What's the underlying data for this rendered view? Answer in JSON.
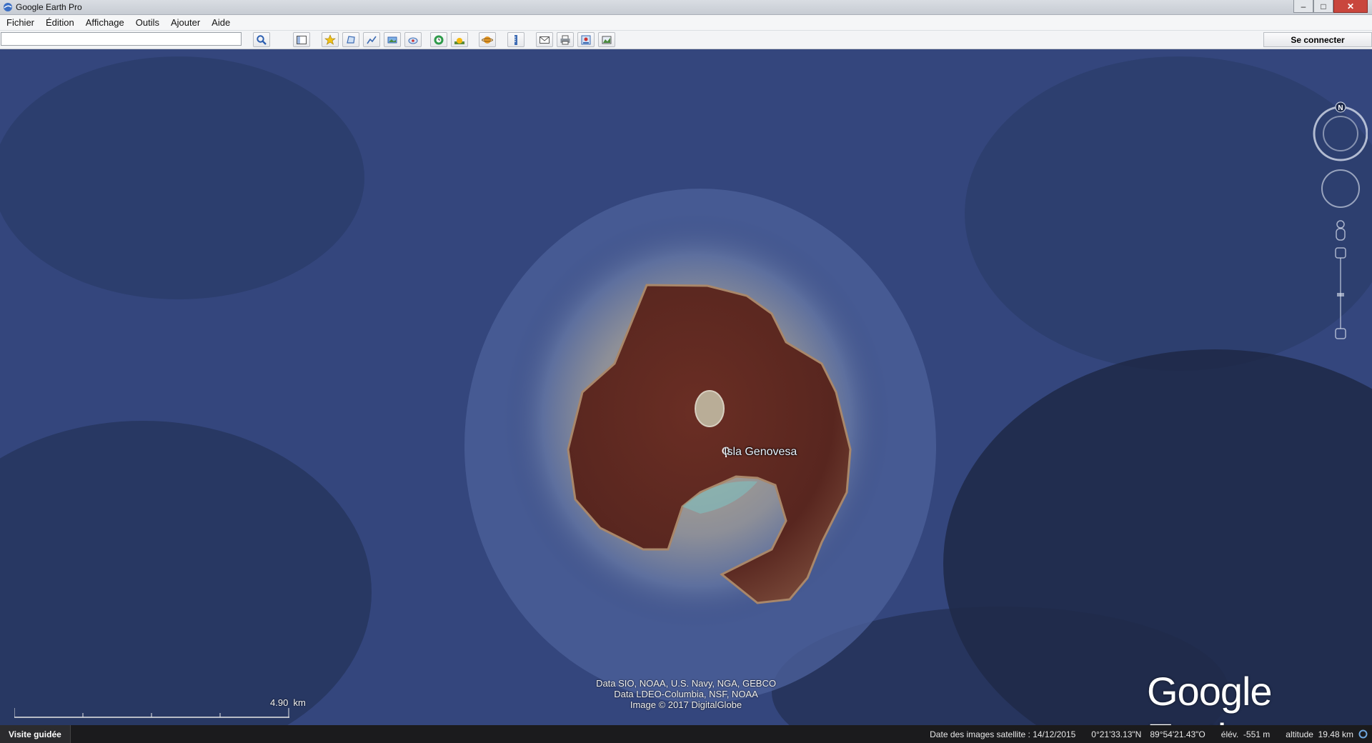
{
  "window": {
    "title": "Google Earth Pro",
    "controls": {
      "minimize": "–",
      "maximize": "□",
      "close": "✕"
    }
  },
  "menu": {
    "items": [
      "Fichier",
      "Édition",
      "Affichage",
      "Outils",
      "Ajouter",
      "Aide"
    ]
  },
  "toolbar": {
    "search_value": "",
    "signin_label": "Se connecter",
    "icons": [
      "search-icon",
      "sidebar-toggle-icon",
      "placemark-icon",
      "polygon-icon",
      "path-icon",
      "image-overlay-icon",
      "record-tour-icon",
      "historical-imagery-icon",
      "sunlight-icon",
      "planets-icon",
      "ruler-icon",
      "email-icon",
      "print-icon",
      "save-image-icon",
      "view-in-maps-icon"
    ]
  },
  "map": {
    "place_label": "Isla Genovesa",
    "attribution": [
      "Data SIO, NOAA, U.S. Navy, NGA, GEBCO",
      "Data LDEO-Columbia, NSF, NOAA",
      "Image © 2017 DigitalGlobe"
    ],
    "logo": "Google Earth",
    "scale": {
      "value": "4.90",
      "unit": "km"
    },
    "compass_north": "N"
  },
  "statusbar": {
    "tour_label": "Visite guidée",
    "imagery_date": "Date des images satellite : 14/12/2015",
    "latitude": "0°21'33.13\"N",
    "longitude": "89°54'21.43\"O",
    "elevation": "élév.  -551 m",
    "altitude": "altitude  19.48 km"
  },
  "colors": {
    "ocean": "#33457a",
    "island": "#5e2a22",
    "reef": "#b9a88a",
    "statusbar": "#1b1b1d"
  }
}
